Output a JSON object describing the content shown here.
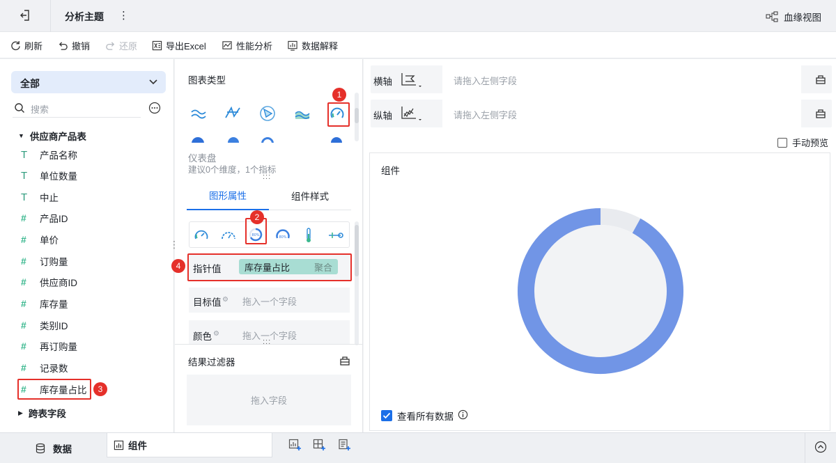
{
  "titlebar": {
    "title": "分析主题",
    "more": "⋮",
    "lineage": "血缘视图"
  },
  "toolbar": {
    "refresh": "刷新",
    "undo": "撤销",
    "redo": "还原",
    "export": "导出Excel",
    "perf": "性能分析",
    "explain": "数据解释"
  },
  "left": {
    "scope": "全部",
    "search_placeholder": "搜索",
    "table_name": "供应商产品表",
    "fields": [
      {
        "icon": "T",
        "label": "产品名称"
      },
      {
        "icon": "T",
        "label": "单位数量"
      },
      {
        "icon": "T",
        "label": "中止"
      },
      {
        "icon": "#",
        "label": "产品ID"
      },
      {
        "icon": "#",
        "label": "单价"
      },
      {
        "icon": "#",
        "label": "订购量"
      },
      {
        "icon": "#",
        "label": "供应商ID"
      },
      {
        "icon": "#",
        "label": "库存量"
      },
      {
        "icon": "#",
        "label": "类别ID"
      },
      {
        "icon": "#",
        "label": "再订购量"
      },
      {
        "icon": "#",
        "label": "记录数"
      },
      {
        "icon": "#",
        "label": "库存量占比"
      }
    ],
    "cross_table": "跨表字段"
  },
  "middle": {
    "chart_type_title": "图表类型",
    "selected_chart_name": "仪表盘",
    "selected_chart_hint": "建议0个维度，1个指标",
    "tabs": [
      "图形属性",
      "组件样式"
    ],
    "pointer_label": "指针值",
    "pointer_field": "库存量占比",
    "pointer_agg": "聚合",
    "target_label": "目标值",
    "target_placeholder": "拖入一个字段",
    "color_label": "颜色",
    "color_placeholder": "拖入一个字段",
    "filter_title": "结果过滤器",
    "filter_placeholder": "拖入字段"
  },
  "right": {
    "x_axis_label": "横轴",
    "x_axis_placeholder": "请拖入左侧字段",
    "y_axis_label": "纵轴",
    "y_axis_placeholder": "请拖入左侧字段",
    "manual_preview": "手动预览",
    "component_title": "组件",
    "view_all": "查看所有数据"
  },
  "gauge": {
    "fill_fraction": 0.92,
    "fill_color": "#7195e6",
    "track_color": "#e9ebef",
    "inner_color": "#f2f3f5"
  },
  "bottom": {
    "data_tab": "数据",
    "component_tab": "组件"
  },
  "annotations": [
    "1",
    "2",
    "3",
    "4"
  ],
  "colors": {
    "accent": "#1b6fe8",
    "highlight_red": "#e5302a",
    "chip_green": "#a8ddd3",
    "field_green": "#3bb88f"
  }
}
